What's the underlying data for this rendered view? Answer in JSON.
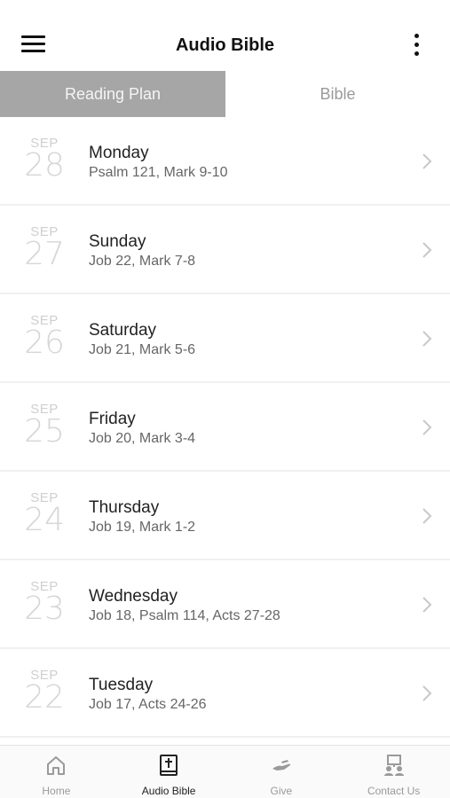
{
  "header": {
    "title": "Audio Bible",
    "menu_icon": "hamburger-icon",
    "more_icon": "more-vertical-icon"
  },
  "tabs": [
    {
      "label": "Reading Plan",
      "active": true
    },
    {
      "label": "Bible",
      "active": false
    }
  ],
  "plan": [
    {
      "month": "SEP",
      "day": "28",
      "weekday": "Monday",
      "readings": "Psalm 121, Mark 9-10"
    },
    {
      "month": "SEP",
      "day": "27",
      "weekday": "Sunday",
      "readings": "Job 22, Mark 7-8"
    },
    {
      "month": "SEP",
      "day": "26",
      "weekday": "Saturday",
      "readings": "Job 21, Mark 5-6"
    },
    {
      "month": "SEP",
      "day": "25",
      "weekday": "Friday",
      "readings": "Job 20, Mark 3-4"
    },
    {
      "month": "SEP",
      "day": "24",
      "weekday": "Thursday",
      "readings": "Job 19, Mark 1-2"
    },
    {
      "month": "SEP",
      "day": "23",
      "weekday": "Wednesday",
      "readings": "Job 18, Psalm 114, Acts 27-28"
    },
    {
      "month": "SEP",
      "day": "22",
      "weekday": "Tuesday",
      "readings": "Job 17, Acts 24-26"
    }
  ],
  "tabbar": [
    {
      "label": "Home",
      "icon": "home-icon",
      "active": false
    },
    {
      "label": "Audio Bible",
      "icon": "bible-icon",
      "active": true
    },
    {
      "label": "Give",
      "icon": "give-hand-icon",
      "active": false
    },
    {
      "label": "Contact Us",
      "icon": "contact-icon",
      "active": false
    }
  ],
  "colors": {
    "active_tab_bg": "#a6a6a6",
    "text_dark": "#222222",
    "text_muted": "#9a9a9a"
  }
}
